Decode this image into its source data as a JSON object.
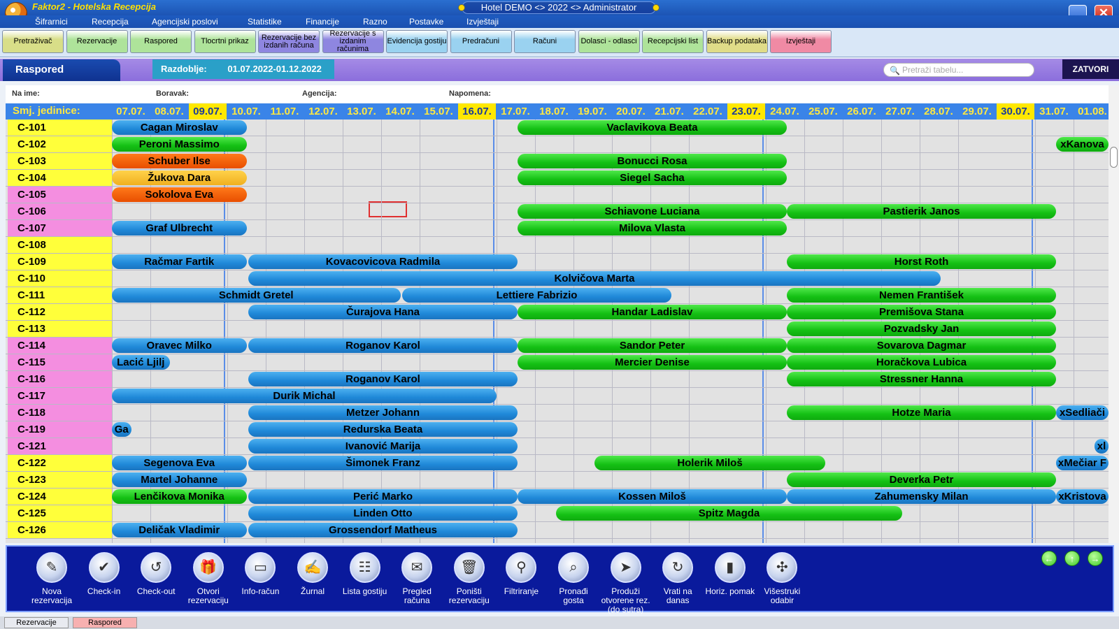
{
  "app": {
    "title": "Faktor2 - Hotelska Recepcija",
    "window_center": "Hotel DEMO <> 2022 <> Administrator"
  },
  "menu": [
    "Šifrarnici",
    "Recepcija",
    "Agencijski poslovi",
    "Statistike",
    "Financije",
    "Razno",
    "Postavke",
    "Izvještaji"
  ],
  "toolbar": [
    {
      "label": "Pretraživač",
      "color": "#d8de88"
    },
    {
      "label": "Rezervacije",
      "color": "#aee39a"
    },
    {
      "label": "Raspored",
      "color": "#aee39a"
    },
    {
      "label": "Tlocrtni prikaz",
      "color": "#aee39a"
    },
    {
      "label": "Rezervacije bez izdanih računa",
      "color": "#8e86e0"
    },
    {
      "label": "Rezervacije s izdanim računima",
      "color": "#8e86e0"
    },
    {
      "label": "Evidencija gostiju",
      "color": "#9ad2f0"
    },
    {
      "label": "Predračuni",
      "color": "#9ad2f0"
    },
    {
      "label": "Računi",
      "color": "#9ad2f0"
    },
    {
      "label": "Dolasci - odlasci",
      "color": "#aee39a"
    },
    {
      "label": "Recepcijski list",
      "color": "#aee39a"
    },
    {
      "label": "Backup podataka",
      "color": "#e0dc88"
    },
    {
      "label": "Izvještaji",
      "color": "#f08aa4"
    }
  ],
  "header": {
    "tab": "Raspored",
    "period_label": "Razdoblje:",
    "period_value": "01.07.2022-01.12.2022",
    "search_placeholder": "Pretraži tabelu...",
    "close": "ZATVORI"
  },
  "filters": [
    "Na ime:",
    "Boravak:",
    "Agencija:",
    "Napomena:"
  ],
  "dates": {
    "label": "Smj. jedinice:",
    "days": [
      "07.07.",
      "08.07.",
      "09.07.",
      "10.07.",
      "11.07.",
      "12.07.",
      "13.07.",
      "14.07.",
      "15.07.",
      "16.07.",
      "17.07.",
      "18.07.",
      "19.07.",
      "20.07.",
      "21.07.",
      "22.07.",
      "23.07.",
      "24.07.",
      "25.07.",
      "26.07.",
      "27.07.",
      "28.07.",
      "29.07.",
      "30.07.",
      "31.07.",
      "01.08."
    ],
    "highlighted": [
      "09.07.",
      "16.07.",
      "23.07.",
      "30.07."
    ]
  },
  "rooms": [
    {
      "name": "C-101",
      "color": "#ffff3a"
    },
    {
      "name": "C-102",
      "color": "#ffff3a"
    },
    {
      "name": "C-103",
      "color": "#ffff3a"
    },
    {
      "name": "C-104",
      "color": "#ffff3a"
    },
    {
      "name": "C-105",
      "color": "#f48ee0"
    },
    {
      "name": "C-106",
      "color": "#f48ee0"
    },
    {
      "name": "C-107",
      "color": "#f48ee0"
    },
    {
      "name": "C-108",
      "color": "#ffff3a"
    },
    {
      "name": "C-109",
      "color": "#ffff3a"
    },
    {
      "name": "C-110",
      "color": "#ffff3a"
    },
    {
      "name": "C-111",
      "color": "#ffff3a"
    },
    {
      "name": "C-112",
      "color": "#ffff3a"
    },
    {
      "name": "C-113",
      "color": "#ffff3a"
    },
    {
      "name": "C-114",
      "color": "#f48ee0"
    },
    {
      "name": "C-115",
      "color": "#f48ee0"
    },
    {
      "name": "C-116",
      "color": "#f48ee0"
    },
    {
      "name": "C-117",
      "color": "#f48ee0"
    },
    {
      "name": "C-118",
      "color": "#f48ee0"
    },
    {
      "name": "C-119",
      "color": "#f48ee0"
    },
    {
      "name": "C-121",
      "color": "#f48ee0"
    },
    {
      "name": "C-122",
      "color": "#ffff3a"
    },
    {
      "name": "C-123",
      "color": "#ffff3a"
    },
    {
      "name": "C-124",
      "color": "#ffff3a"
    },
    {
      "name": "C-125",
      "color": "#ffff3a"
    },
    {
      "name": "C-126",
      "color": "#ffff3a"
    }
  ],
  "bookings": [
    {
      "room": "C-101",
      "guest": "Cagan Miroslav",
      "start": "07.07.",
      "nights": 3.5,
      "status": "blue"
    },
    {
      "room": "C-101",
      "guest": "Vaclavikova Beata",
      "start": "17.07.",
      "nights": 7,
      "status": "green"
    },
    {
      "room": "C-102",
      "guest": "Peroni Massimo",
      "start": "07.07.",
      "nights": 3.5,
      "status": "green"
    },
    {
      "room": "C-102",
      "guest": "xKanova",
      "start": "31.07.",
      "nights": 1.5,
      "status": "green"
    },
    {
      "room": "C-103",
      "guest": "Schuber Ilse",
      "start": "07.07.",
      "nights": 3.5,
      "status": "orange"
    },
    {
      "room": "C-103",
      "guest": "Bonucci Rosa",
      "start": "17.07.",
      "nights": 7,
      "status": "green"
    },
    {
      "room": "C-104",
      "guest": "Žukova Dara",
      "start": "07.07.",
      "nights": 3.5,
      "status": "yellow"
    },
    {
      "room": "C-104",
      "guest": "Siegel Sacha",
      "start": "17.07.",
      "nights": 7,
      "status": "green"
    },
    {
      "room": "C-105",
      "guest": "Sokolova Eva",
      "start": "07.07.",
      "nights": 3.5,
      "status": "orange"
    },
    {
      "room": "C-106",
      "guest": "Schiavone Luciana",
      "start": "17.07.",
      "nights": 7,
      "status": "green"
    },
    {
      "room": "C-106",
      "guest": "Pastierik Janos",
      "start": "24.07.",
      "nights": 7,
      "status": "green"
    },
    {
      "room": "C-107",
      "guest": "Graf Ulbrecht",
      "start": "07.07.",
      "nights": 3.5,
      "status": "blue"
    },
    {
      "room": "C-107",
      "guest": "Milova Vlasta",
      "start": "17.07.",
      "nights": 7,
      "status": "green"
    },
    {
      "room": "C-109",
      "guest": "Račmar Fartik",
      "start": "07.07.",
      "nights": 3.5,
      "status": "blue"
    },
    {
      "room": "C-109",
      "guest": "Kovacovicova Radmila",
      "start": "10.07.",
      "nights": 7,
      "status": "blue"
    },
    {
      "room": "C-109",
      "guest": "Horst Roth",
      "start": "24.07.",
      "nights": 7,
      "status": "green"
    },
    {
      "room": "C-110",
      "guest": "Kolvičova Marta",
      "start": "10.07.",
      "nights": 18,
      "status": "blue"
    },
    {
      "room": "C-111",
      "guest": "Schmidt Gretel",
      "start": "07.07.",
      "nights": 7.5,
      "status": "blue"
    },
    {
      "room": "C-111",
      "guest": "Lettiere Fabrizio",
      "start": "14.07.",
      "nights": 7,
      "status": "blue"
    },
    {
      "room": "C-111",
      "guest": "Nemen František",
      "start": "24.07.",
      "nights": 7,
      "status": "green"
    },
    {
      "room": "C-112",
      "guest": "Čurajova Hana",
      "start": "10.07.",
      "nights": 7,
      "status": "blue"
    },
    {
      "room": "C-112",
      "guest": "Handar Ladislav",
      "start": "17.07.",
      "nights": 7,
      "status": "green"
    },
    {
      "room": "C-112",
      "guest": "Premišova Stana",
      "start": "24.07.",
      "nights": 7,
      "status": "green"
    },
    {
      "room": "C-113",
      "guest": "Pozvadsky Jan",
      "start": "24.07.",
      "nights": 7,
      "status": "green"
    },
    {
      "room": "C-114",
      "guest": "Oravec Milko",
      "start": "07.07.",
      "nights": 3.5,
      "status": "blue"
    },
    {
      "room": "C-114",
      "guest": "Roganov Karol",
      "start": "10.07.",
      "nights": 7,
      "status": "blue"
    },
    {
      "room": "C-114",
      "guest": "Sandor Peter",
      "start": "17.07.",
      "nights": 7,
      "status": "green"
    },
    {
      "room": "C-114",
      "guest": "Sovarova Dagmar",
      "start": "24.07.",
      "nights": 7,
      "status": "green"
    },
    {
      "room": "C-115",
      "guest": "Lacić Ljilj",
      "start": "07.07.",
      "nights": 1.5,
      "status": "blue"
    },
    {
      "room": "C-115",
      "guest": "Mercier Denise",
      "start": "17.07.",
      "nights": 7,
      "status": "green"
    },
    {
      "room": "C-115",
      "guest": "Horačkova Lubica",
      "start": "24.07.",
      "nights": 7,
      "status": "green"
    },
    {
      "room": "C-116",
      "guest": "Roganov Karol",
      "start": "10.07.",
      "nights": 7,
      "status": "blue"
    },
    {
      "room": "C-116",
      "guest": "Stressner Hanna",
      "start": "24.07.",
      "nights": 7,
      "status": "green"
    },
    {
      "room": "C-117",
      "guest": "Durik Michal",
      "start": "07.07.",
      "nights": 10,
      "status": "blue"
    },
    {
      "room": "C-118",
      "guest": "Metzer Johann",
      "start": "10.07.",
      "nights": 7,
      "status": "blue"
    },
    {
      "room": "C-118",
      "guest": "Hotze Maria",
      "start": "24.07.",
      "nights": 7,
      "status": "green"
    },
    {
      "room": "C-118",
      "guest": "xSedliači",
      "start": "31.07.",
      "nights": 1.5,
      "status": "blue"
    },
    {
      "room": "C-119",
      "guest": "Ga",
      "start": "07.07.",
      "nights": 0.5,
      "status": "blue"
    },
    {
      "room": "C-119",
      "guest": "Redurska Beata",
      "start": "10.07.",
      "nights": 7,
      "status": "blue"
    },
    {
      "room": "C-121",
      "guest": "Ivanović Marija",
      "start": "10.07.",
      "nights": 7,
      "status": "blue"
    },
    {
      "room": "C-121",
      "guest": "xl",
      "start": "01.08.",
      "nights": 0.5,
      "status": "blue"
    },
    {
      "room": "C-122",
      "guest": "Segenova Eva",
      "start": "07.07.",
      "nights": 3.5,
      "status": "blue"
    },
    {
      "room": "C-122",
      "guest": "Šimonek Franz",
      "start": "10.07.",
      "nights": 7,
      "status": "blue"
    },
    {
      "room": "C-122",
      "guest": "Holerik Miloš",
      "start": "19.07.",
      "nights": 6,
      "status": "green"
    },
    {
      "room": "C-122",
      "guest": "xMečiar F",
      "start": "31.07.",
      "nights": 1.5,
      "status": "blue"
    },
    {
      "room": "C-123",
      "guest": "Martel Johanne",
      "start": "07.07.",
      "nights": 3.5,
      "status": "blue"
    },
    {
      "room": "C-123",
      "guest": "Deverka Petr",
      "start": "24.07.",
      "nights": 7,
      "status": "green"
    },
    {
      "room": "C-124",
      "guest": "Lenčikova Monika",
      "start": "07.07.",
      "nights": 3.5,
      "status": "green"
    },
    {
      "room": "C-124",
      "guest": "Perić Marko",
      "start": "10.07.",
      "nights": 7,
      "status": "blue"
    },
    {
      "room": "C-124",
      "guest": "Kossen Miloš",
      "start": "17.07.",
      "nights": 7,
      "status": "blue"
    },
    {
      "room": "C-124",
      "guest": "Zahumensky Milan",
      "start": "24.07.",
      "nights": 7,
      "status": "blue"
    },
    {
      "room": "C-124",
      "guest": "xKristova",
      "start": "31.07.",
      "nights": 1.5,
      "status": "blue"
    },
    {
      "room": "C-125",
      "guest": "Linden Otto",
      "start": "10.07.",
      "nights": 7,
      "status": "blue"
    },
    {
      "room": "C-125",
      "guest": "Spitz Magda",
      "start": "18.07.",
      "nights": 9,
      "status": "green"
    },
    {
      "room": "C-126",
      "guest": "Deličak Vladimir",
      "start": "07.07.",
      "nights": 3.5,
      "status": "blue"
    },
    {
      "room": "C-126",
      "guest": "Grossendorf Matheus",
      "start": "10.07.",
      "nights": 7,
      "status": "blue"
    }
  ],
  "actions": [
    {
      "label": "Nova rezervacija",
      "icon": "new-reservation-icon",
      "glyph": "✎"
    },
    {
      "label": "Check-in",
      "icon": "check-in-icon",
      "glyph": "✔"
    },
    {
      "label": "Check-out",
      "icon": "check-out-icon",
      "glyph": "↺"
    },
    {
      "label": "Otvori rezervaciju",
      "icon": "gift-icon",
      "glyph": "🎁"
    },
    {
      "label": "Info-račun",
      "icon": "card-icon",
      "glyph": "▭"
    },
    {
      "label": "Žurnal",
      "icon": "journal-icon",
      "glyph": "✍"
    },
    {
      "label": "Lista gostiju",
      "icon": "guest-list-icon",
      "glyph": "☷"
    },
    {
      "label": "Pregled računa",
      "icon": "invoices-icon",
      "glyph": "✉"
    },
    {
      "label": "Poništi rezervaciju",
      "icon": "trash-icon",
      "glyph": "🗑"
    },
    {
      "label": "Filtriranje",
      "icon": "filter-icon",
      "glyph": "⚲"
    },
    {
      "label": "Pronađi gosta",
      "icon": "find-guest-icon",
      "glyph": "⌕"
    },
    {
      "label": "Produži otvorene rez. (do sutra)",
      "icon": "extend-icon",
      "glyph": "➤"
    },
    {
      "label": "Vrati na danas",
      "icon": "today-icon",
      "glyph": "↻"
    },
    {
      "label": "Horiz. pomak",
      "icon": "horizontal-shift-icon",
      "glyph": "▮"
    },
    {
      "label": "Višestruki odabir",
      "icon": "multi-select-icon",
      "glyph": "✣"
    }
  ],
  "nav_arrows": [
    {
      "name": "nav-left-icon",
      "glyph": "←"
    },
    {
      "name": "nav-up-icon",
      "glyph": "↑"
    },
    {
      "name": "nav-right-icon",
      "glyph": "→"
    }
  ],
  "bottom_tabs": [
    {
      "label": "Rezervacije",
      "active": false
    },
    {
      "label": "Raspored",
      "active": true
    }
  ]
}
